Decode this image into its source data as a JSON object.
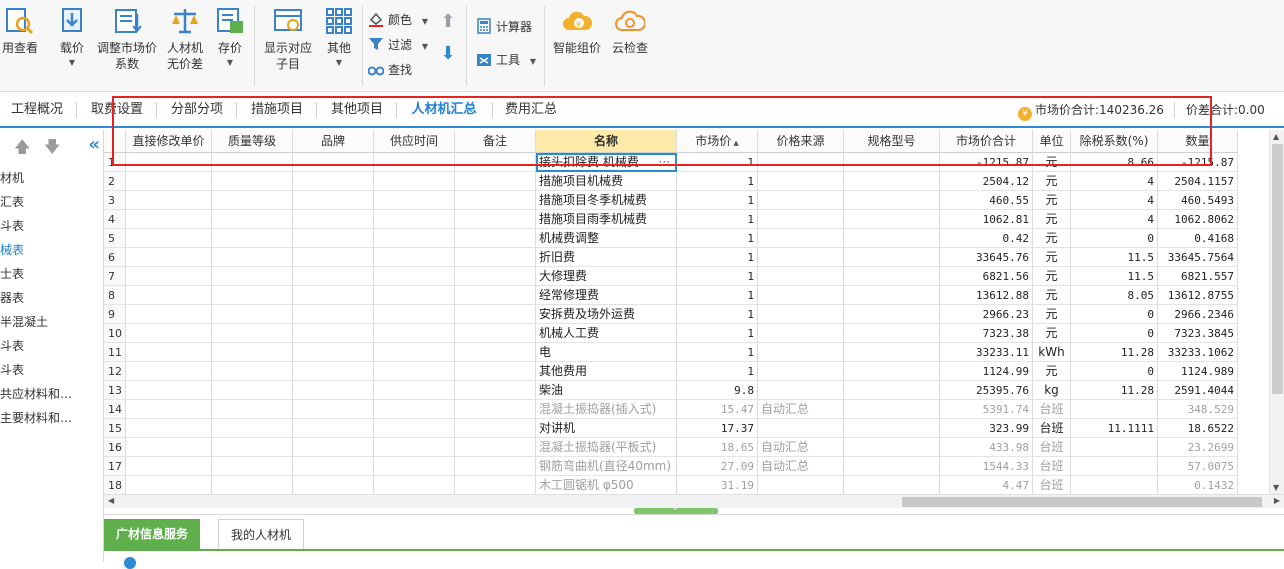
{
  "toolbar": {
    "b1": {
      "label": "用查看"
    },
    "b2": {
      "label": "载价"
    },
    "b3": {
      "label1": "调整市场价",
      "label2": "系数"
    },
    "b4": {
      "label1": "人材机",
      "label2": "无价差"
    },
    "b5": {
      "label": "存价"
    },
    "b6": {
      "label1": "显示对应",
      "label2": "子目"
    },
    "b7": {
      "label": "其他"
    },
    "color": "颜色",
    "filter": "过滤",
    "find": "查找",
    "calculator": "计算器",
    "tools": "工具",
    "smart_price": "智能组价",
    "cloud_check": "云检查"
  },
  "tabs": [
    "工程概况",
    "取费设置",
    "分部分项",
    "措施项目",
    "其他项目",
    "人材机汇总",
    "费用汇总"
  ],
  "active_tab": "人材机汇总",
  "summary": {
    "market_total": "市场价合计:140236.26",
    "diff_total": "价差合计:0.00"
  },
  "left_panel": {
    "items": [
      "材机",
      "汇表",
      "斗表",
      "械表",
      "士表",
      "器表",
      "半混凝土",
      "斗表",
      "斗表",
      "共应材料和…",
      "主要材料和…"
    ],
    "selected_index": 3
  },
  "columns": [
    "直接修改单价",
    "质量等级",
    "品牌",
    "供应时间",
    "备注",
    "名称",
    "市场价",
    "价格来源",
    "规格型号",
    "市场价合计",
    "单位",
    "除税系数(%)",
    "数量"
  ],
  "rows": [
    {
      "n": "1",
      "name": "接头扣除费 机械费",
      "price": "1",
      "src": "",
      "total": "-1215.87",
      "unit": "元",
      "tax": "8.66",
      "qty": "-1215.87",
      "gray": false
    },
    {
      "n": "2",
      "name": "措施项目机械费",
      "price": "1",
      "src": "",
      "total": "2504.12",
      "unit": "元",
      "tax": "4",
      "qty": "2504.1157",
      "gray": false
    },
    {
      "n": "3",
      "name": "措施项目冬季机械费",
      "price": "1",
      "src": "",
      "total": "460.55",
      "unit": "元",
      "tax": "4",
      "qty": "460.5493",
      "gray": false
    },
    {
      "n": "4",
      "name": "措施项目雨季机械费",
      "price": "1",
      "src": "",
      "total": "1062.81",
      "unit": "元",
      "tax": "4",
      "qty": "1062.8062",
      "gray": false
    },
    {
      "n": "5",
      "name": "机械费调整",
      "price": "1",
      "src": "",
      "total": "0.42",
      "unit": "元",
      "tax": "0",
      "qty": "0.4168",
      "gray": false
    },
    {
      "n": "6",
      "name": "折旧费",
      "price": "1",
      "src": "",
      "total": "33645.76",
      "unit": "元",
      "tax": "11.5",
      "qty": "33645.7564",
      "gray": false
    },
    {
      "n": "7",
      "name": "大修理费",
      "price": "1",
      "src": "",
      "total": "6821.56",
      "unit": "元",
      "tax": "11.5",
      "qty": "6821.557",
      "gray": false
    },
    {
      "n": "8",
      "name": "经常修理费",
      "price": "1",
      "src": "",
      "total": "13612.88",
      "unit": "元",
      "tax": "8.05",
      "qty": "13612.8755",
      "gray": false
    },
    {
      "n": "9",
      "name": "安拆费及场外运费",
      "price": "1",
      "src": "",
      "total": "2966.23",
      "unit": "元",
      "tax": "0",
      "qty": "2966.2346",
      "gray": false
    },
    {
      "n": "10",
      "name": "机械人工费",
      "price": "1",
      "src": "",
      "total": "7323.38",
      "unit": "元",
      "tax": "0",
      "qty": "7323.3845",
      "gray": false
    },
    {
      "n": "11",
      "name": "电",
      "price": "1",
      "src": "",
      "total": "33233.11",
      "unit": "kWh",
      "tax": "11.28",
      "qty": "33233.1062",
      "gray": false
    },
    {
      "n": "12",
      "name": "其他费用",
      "price": "1",
      "src": "",
      "total": "1124.99",
      "unit": "元",
      "tax": "0",
      "qty": "1124.989",
      "gray": false
    },
    {
      "n": "13",
      "name": "柴油",
      "price": "9.8",
      "src": "",
      "total": "25395.76",
      "unit": "kg",
      "tax": "11.28",
      "qty": "2591.4044",
      "gray": false
    },
    {
      "n": "14",
      "name": "混凝土振捣器(插入式)",
      "price": "15.47",
      "src": "自动汇总",
      "total": "5391.74",
      "unit": "台班",
      "tax": "",
      "qty": "348.529",
      "gray": true
    },
    {
      "n": "15",
      "name": "对讲机",
      "price": "17.37",
      "src": "",
      "total": "323.99",
      "unit": "台班",
      "tax": "11.1111",
      "qty": "18.6522",
      "gray": false
    },
    {
      "n": "16",
      "name": "混凝土振捣器(平板式)",
      "price": "18.65",
      "src": "自动汇总",
      "total": "433.98",
      "unit": "台班",
      "tax": "",
      "qty": "23.2699",
      "gray": true
    },
    {
      "n": "17",
      "name": "钢筋弯曲机(直径40mm)",
      "price": "27.09",
      "src": "自动汇总",
      "total": "1544.33",
      "unit": "台班",
      "tax": "",
      "qty": "57.0075",
      "gray": true
    },
    {
      "n": "18",
      "name": "木工圆锯机 φ500",
      "price": "31.19",
      "src": "",
      "total": "4.47",
      "unit": "台班",
      "tax": "",
      "qty": "0.1432",
      "gray": true
    }
  ],
  "bottom_tabs": [
    "广材信息服务",
    "我的人材机"
  ],
  "colors": {
    "accent": "#2a8ad4",
    "green": "#5fb04c",
    "annotation": "#e8231f",
    "name_header": "#fde9a8"
  }
}
